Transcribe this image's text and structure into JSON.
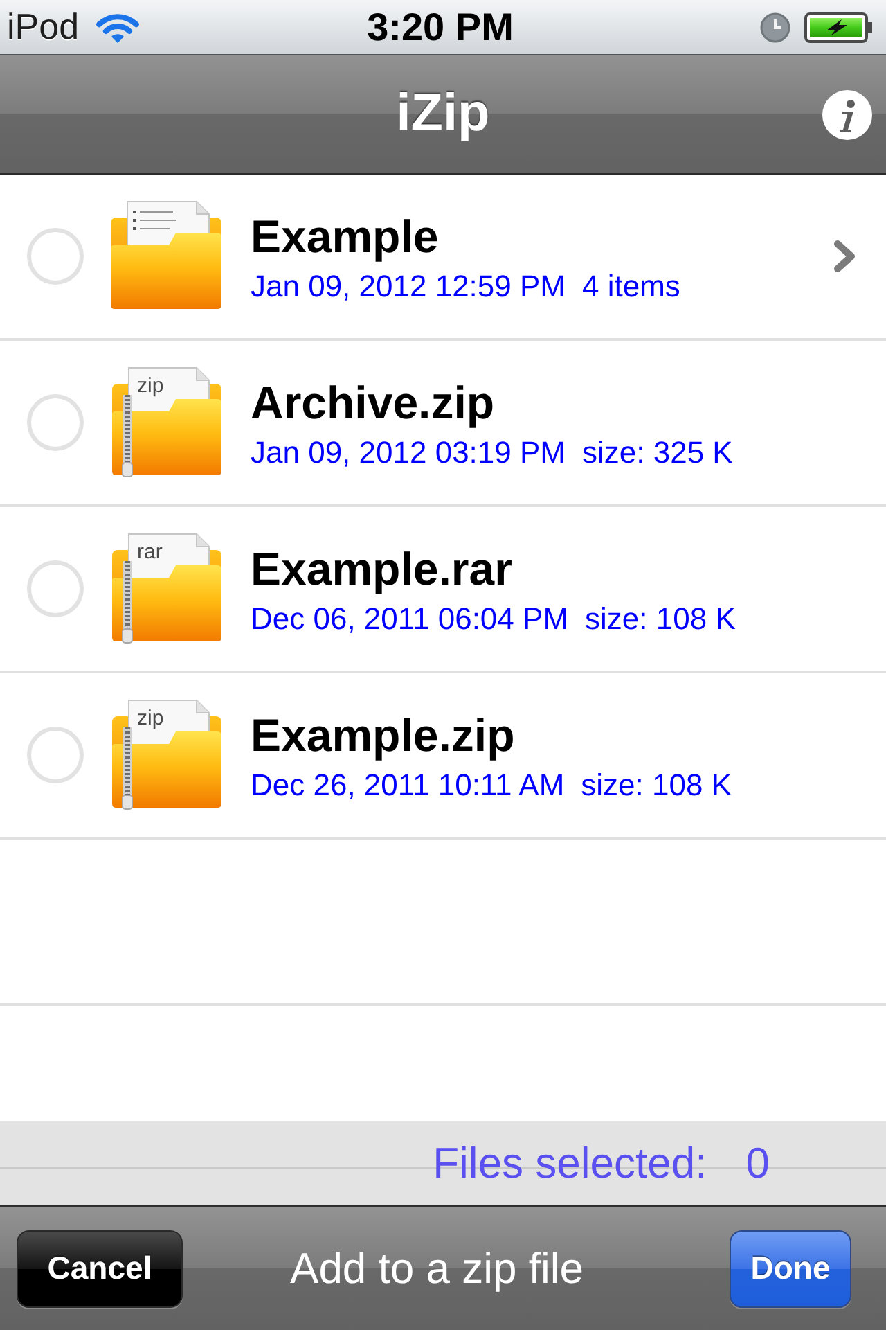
{
  "status_bar": {
    "carrier": "iPod",
    "time": "3:20 PM"
  },
  "nav_bar": {
    "title": "iZip"
  },
  "files": [
    {
      "kind": "folder",
      "name": "Example",
      "date": "Jan 09, 2012 12:59 PM",
      "detail": "4 items",
      "selected": false,
      "disclosure": true
    },
    {
      "kind": "archive",
      "type_label": "zip",
      "name": "Archive.zip",
      "date": "Jan 09, 2012 03:19 PM",
      "detail": "size: 325 K",
      "selected": false,
      "disclosure": false
    },
    {
      "kind": "archive",
      "type_label": "rar",
      "name": "Example.rar",
      "date": "Dec 06, 2011 06:04 PM",
      "detail": "size: 108 K",
      "selected": false,
      "disclosure": false
    },
    {
      "kind": "archive",
      "type_label": "zip",
      "name": "Example.zip",
      "date": "Dec 26, 2011 10:11 AM",
      "detail": "size: 108 K",
      "selected": false,
      "disclosure": false
    }
  ],
  "selection_summary": {
    "label": "Files selected:",
    "count": "0"
  },
  "toolbar": {
    "cancel": "Cancel",
    "title": "Add to a zip file",
    "done": "Done"
  }
}
